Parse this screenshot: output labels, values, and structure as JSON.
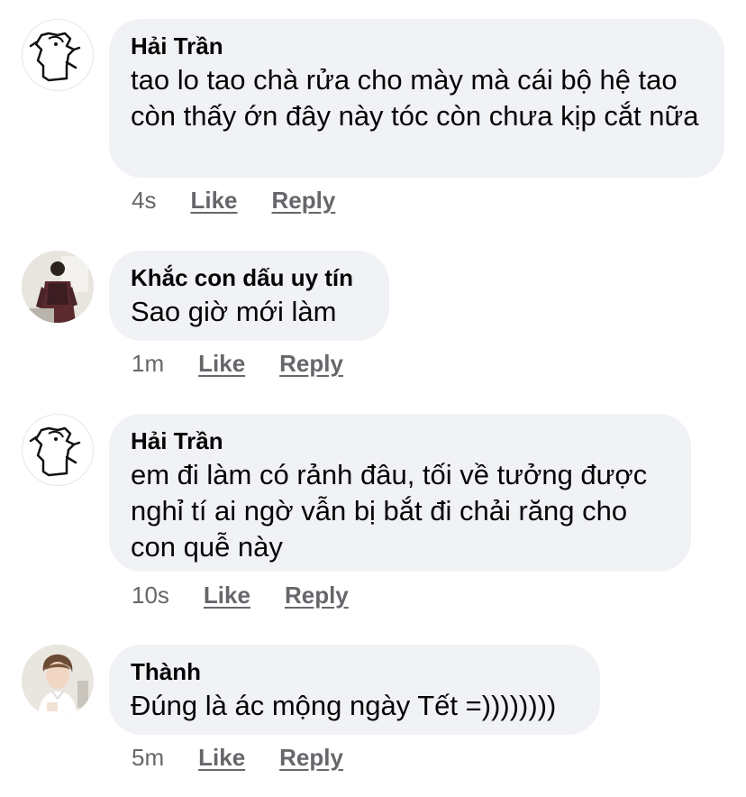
{
  "comments": [
    {
      "author": "Hải Trần",
      "avatar_icon": "sketch-drawing-avatar-icon",
      "text": "tao lo tao chà rửa cho mày mà cái bộ hệ tao còn thấy ớn đây này tóc còn chưa kịp cắt nữa",
      "time": "4s",
      "like": "Like",
      "reply": "Reply"
    },
    {
      "author": "Khắc con dấu uy tín",
      "avatar_icon": "person-photo-avatar-icon",
      "text": "Sao giờ mới làm",
      "time": "1m",
      "like": "Like",
      "reply": "Reply"
    },
    {
      "author": "Hải Trần",
      "avatar_icon": "sketch-drawing-avatar-icon",
      "text": "em đi làm có rảnh đâu, tối về tưởng được nghỉ tí ai ngờ vẫn bị bắt đi chải răng cho con quễ này",
      "time": "10s",
      "like": "Like",
      "reply": "Reply"
    },
    {
      "author": "Thành",
      "avatar_icon": "person-photo-avatar-icon",
      "text": "Đúng là ác mộng ngày Tết =))))))))",
      "time": "5m",
      "like": "Like",
      "reply": "Reply"
    }
  ],
  "colors": {
    "bubble": "#f0f2f5",
    "text": "#050505",
    "meta": "#65676b"
  }
}
